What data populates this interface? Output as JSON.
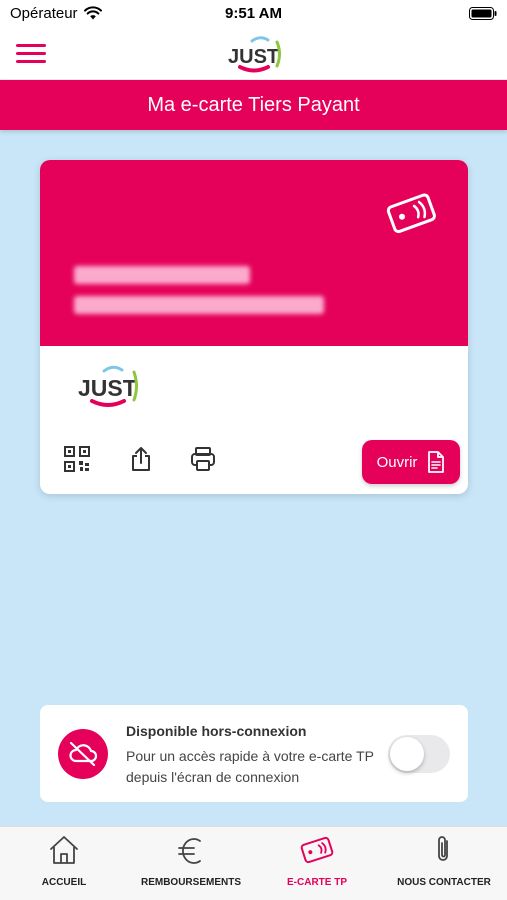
{
  "status_bar": {
    "carrier": "Opérateur",
    "time": "9:51 AM"
  },
  "header": {
    "logo_text": "JUST"
  },
  "page": {
    "title": "Ma e-carte Tiers Payant"
  },
  "card": {
    "logo_text": "JUST",
    "open_label": "Ouvrir"
  },
  "offline": {
    "title": "Disponible hors-connexion",
    "description": "Pour un accès rapide à votre e-carte TP depuis l'écran de connexion",
    "enabled": false
  },
  "tabs": [
    {
      "label": "ACCUEIL",
      "icon": "home-icon",
      "active": false
    },
    {
      "label": "REMBOURSEMENTS",
      "icon": "euro-icon",
      "active": false
    },
    {
      "label": "E-CARTE TP",
      "icon": "card-icon",
      "active": true
    },
    {
      "label": "NOUS CONTACTER",
      "icon": "paperclip-icon",
      "active": false
    }
  ],
  "colors": {
    "brand": "#e5005a",
    "background": "#c8e6f8"
  }
}
